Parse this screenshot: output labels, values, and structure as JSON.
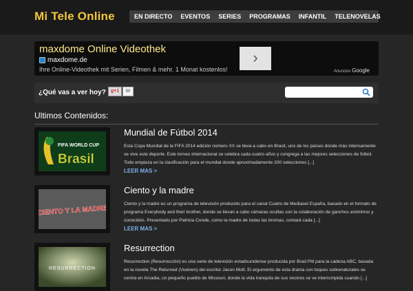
{
  "header": {
    "logo": "Mi Tele Online",
    "nav": [
      "EN DIRECTO",
      "EVENTOS",
      "SERIES",
      "PROGRAMAS",
      "INFANTIL",
      "TELENOVELAS"
    ]
  },
  "ad": {
    "title": "maxdome Online Videothek",
    "domain": "maxdome.de",
    "description": "Ihre Online-Videothek mit Serien, Filmen & mehr. 1 Monat kostenlos!",
    "arrow": "›",
    "label_prefix": "Anuncios",
    "label_brand": "Google"
  },
  "search": {
    "question": "¿Qué vas a ver hoy?",
    "gplus_label": "g+1",
    "gplus_count": "50",
    "placeholder": ""
  },
  "section_title": "Ultimos Contenidos:",
  "posts": [
    {
      "title": "Mundial de Fútbol 2014",
      "thumb_text": "FIFA WORLD CUP",
      "thumb_text2": "Brasil",
      "description": "Esta Copa Mundial de la FIFA 2014 edición número XX se lleva a cabo en Brasil, uno de los países donde más intensamente se vive este deporte. Este torneo internacional se celebra cada cuatro años y congrega a las mejores selecciones de fútbol. Todo empieza en la clasificación para el mundial donde aproximadamente 200 selecciones [...]",
      "more": "LEER MAS >"
    },
    {
      "title": "Ciento y la madre",
      "thumb_text": "CIENTO Y LA MADRE",
      "description": "Ciento y la madre es un programa de televisión producido para el canal Cuatro de Mediaset España, basado en el formato de programa Everybody and their brother, donde se llevan a cabo cámaras ocultas con la colaboración de ganchos anónimos y conocidos. Presentado por Patricia Conde, como la madre de todas las bromas, contará cada [...]",
      "more": "LEER MAS >"
    },
    {
      "title": "Resurrection",
      "thumb_text": "RESURRECTION",
      "description": "Resurrection (Resurrección) es una serie de televisión estadounidense producida por Brad Pitt para la cadena ABC, basada en la novela The Returned (Vuelven) del escritor Jason Mott. El argumento de esta drama con toques sobrenaturales se centra en Arcadia, un pequeño pueblo de Missouri, donde la vida tranquila de sus vecinos se ve interrumpida cuando [...]",
      "more": "LEER MAS >"
    }
  ],
  "colors": {
    "accent": "#f2c83a",
    "link": "#7fb0e8",
    "ad_title": "#ffe98a"
  }
}
